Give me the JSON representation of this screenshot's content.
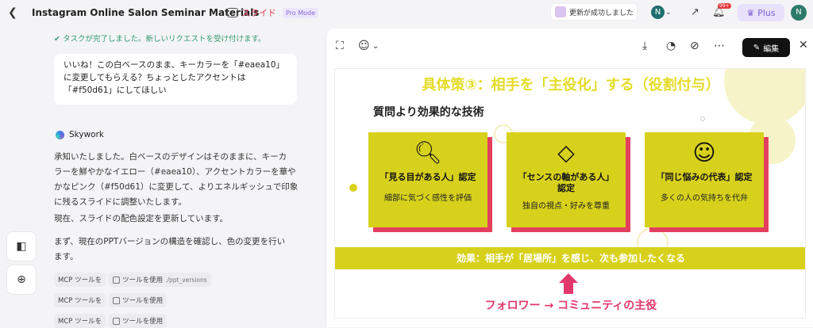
{
  "header": {
    "back_icon": "back-arrow-icon",
    "title": "Instagram Online Salon Seminar Materials",
    "mode_label": "スライド",
    "pro_badge": "Pro Mode",
    "toast": "更新が成功しました",
    "workspace_avatar": "N",
    "plus_label": "Plus",
    "notification_badge": "99+",
    "user_avatar": "N"
  },
  "chat": {
    "task_status": "タスクが完了しました。新しいリクエストを受け付けます。",
    "user_message": [
      "いいね！この白ベースのまま、キーカラーを「#eaea10」",
      "に変更してもらえる？ちょっとしたアクセントは",
      "「#f50d61」にしてほしい"
    ],
    "bot_name": "Skywork",
    "reply_1": [
      "承知いたしました。白ベースのデザインはそのままに、キーカ",
      "ラーを鮮やかなイエロー（#eaea10）、アクセントカラーを華や",
      "かなピンク（#f50d61）に変更して、よりエネルギッシュで印象",
      "に残るスライドに調整いたします。"
    ],
    "reply_2": "現在、スライドの配色設定を更新しています。",
    "reply_3": [
      "まず、現在のPPTバージョンの構造を確認し、色の変更を行い",
      "ます。"
    ],
    "tool_calls": [
      {
        "mcp": "MCP ツールを",
        "use": "ツールを使用",
        "path": "./ppt_versions"
      },
      {
        "mcp": "MCP ツールを",
        "use": "ツールを使用",
        "path": ""
      },
      {
        "mcp": "MCP ツールを",
        "use": "ツールを使用",
        "path": ""
      }
    ]
  },
  "panel": {
    "edit_label": "編集"
  },
  "slide": {
    "title": "具体策③：相手を「主役化」する（役割付与）",
    "subtitle": "質問より効果的な技術",
    "cards": [
      {
        "icon": "eye-magnifier-icon",
        "name": "「見る目がある人」認定",
        "desc": "細部に気づく感性を評価"
      },
      {
        "icon": "diamond-icon",
        "name": "「センスの軸がある人」\n認定",
        "desc": "独自の視点・好みを尊重"
      },
      {
        "icon": "group-chat-icon",
        "name": "「同じ悩みの代表」認定",
        "desc": "多くの人の気持ちを代弁"
      }
    ],
    "effect": "効果：相手が「居場所」を感じ、次も参加したくなる",
    "bottom": "フォロワー → コミュニティの主役",
    "colors": {
      "key": "#d8d11c",
      "accent": "#e3405f"
    }
  }
}
